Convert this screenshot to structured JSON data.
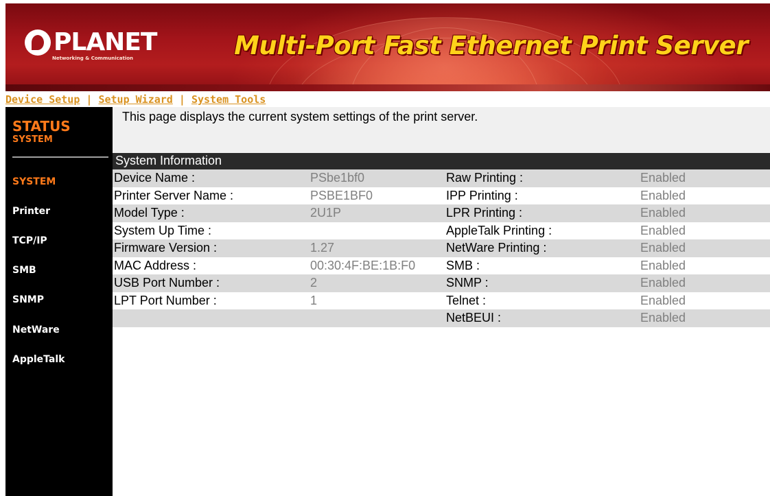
{
  "banner": {
    "logo_text": "PLANET",
    "logo_tagline": "Networking & Communication",
    "title": "Multi-Port Fast Ethernet Print Server"
  },
  "topnav": {
    "items": [
      "Device Setup",
      "Setup Wizard",
      "System Tools"
    ],
    "separator": "|"
  },
  "sidebar": {
    "section_title": "STATUS",
    "section_subtitle": "SYSTEM",
    "items": [
      {
        "label": "SYSTEM",
        "active": true
      },
      {
        "label": "Printer",
        "active": false
      },
      {
        "label": "TCP/IP",
        "active": false
      },
      {
        "label": "SMB",
        "active": false
      },
      {
        "label": "SNMP",
        "active": false
      },
      {
        "label": "NetWare",
        "active": false
      },
      {
        "label": "AppleTalk",
        "active": false
      }
    ]
  },
  "main": {
    "intro": "This page displays the current system settings of the print server.",
    "section_header": "System Information",
    "rows": [
      {
        "label": "Device Name :",
        "value": "PSbe1bf0",
        "label2": "Raw Printing :",
        "value2": "Enabled"
      },
      {
        "label": "Printer Server Name :",
        "value": "PSBE1BF0",
        "label2": "IPP Printing :",
        "value2": "Enabled"
      },
      {
        "label": "Model Type :",
        "value": "2U1P",
        "label2": "LPR Printing :",
        "value2": "Enabled"
      },
      {
        "label": "System Up Time :",
        "value": "",
        "label2": "AppleTalk Printing :",
        "value2": "Enabled"
      },
      {
        "label": "Firmware Version :",
        "value": "1.27",
        "label2": "NetWare Printing :",
        "value2": "Enabled"
      },
      {
        "label": "MAC Address :",
        "value": "00:30:4F:BE:1B:F0",
        "label2": "SMB :",
        "value2": "Enabled"
      },
      {
        "label": "USB Port Number :",
        "value": "2",
        "label2": "SNMP :",
        "value2": "Enabled"
      },
      {
        "label": "LPT Port Number :",
        "value": "1",
        "label2": "Telnet :",
        "value2": "Enabled"
      },
      {
        "label": "",
        "value": "",
        "label2": "NetBEUI :",
        "value2": "Enabled"
      }
    ]
  },
  "colors": {
    "banner_red": "#a3141a",
    "title_yellow": "#ffd21a",
    "nav_orange": "#d99220",
    "sidebar_accent": "#ff7a1a",
    "row_shade": "#d9d9d9",
    "header_bar": "#2a2a2a"
  }
}
